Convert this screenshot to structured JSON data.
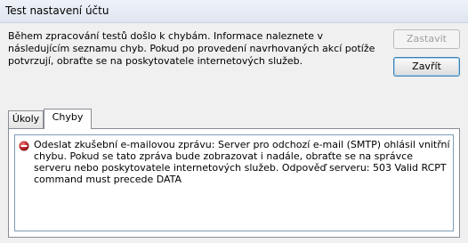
{
  "window": {
    "title": "Test nastavení účtu"
  },
  "intro": {
    "text": "Během zpracování testů došlo k chybám. Informace naleznete v následujícím seznamu chyb. Pokud po provedení navrhovaných akcí potíže potvrzují, obraťte se na poskytovatele internetových služeb."
  },
  "buttons": {
    "stop": "Zastavit",
    "close": "Zavřít"
  },
  "tabs": [
    {
      "label": "Úkoly"
    },
    {
      "label": "Chyby"
    }
  ],
  "errors": [
    {
      "icon": "error-icon",
      "text": "Odeslat zkušební e-mailovou zprávu: Server pro odchozí e-mail (SMTP) ohlásil vnitřní chybu. Pokud se tato zpráva bude zobrazovat i nadále, obraťte se na správce serveru nebo poskytovatele internetových služeb.  Odpověď serveru: 503 Valid RCPT command must precede DATA"
    }
  ],
  "colors": {
    "error": "#c0272d",
    "accent": "#3c7fb1"
  }
}
